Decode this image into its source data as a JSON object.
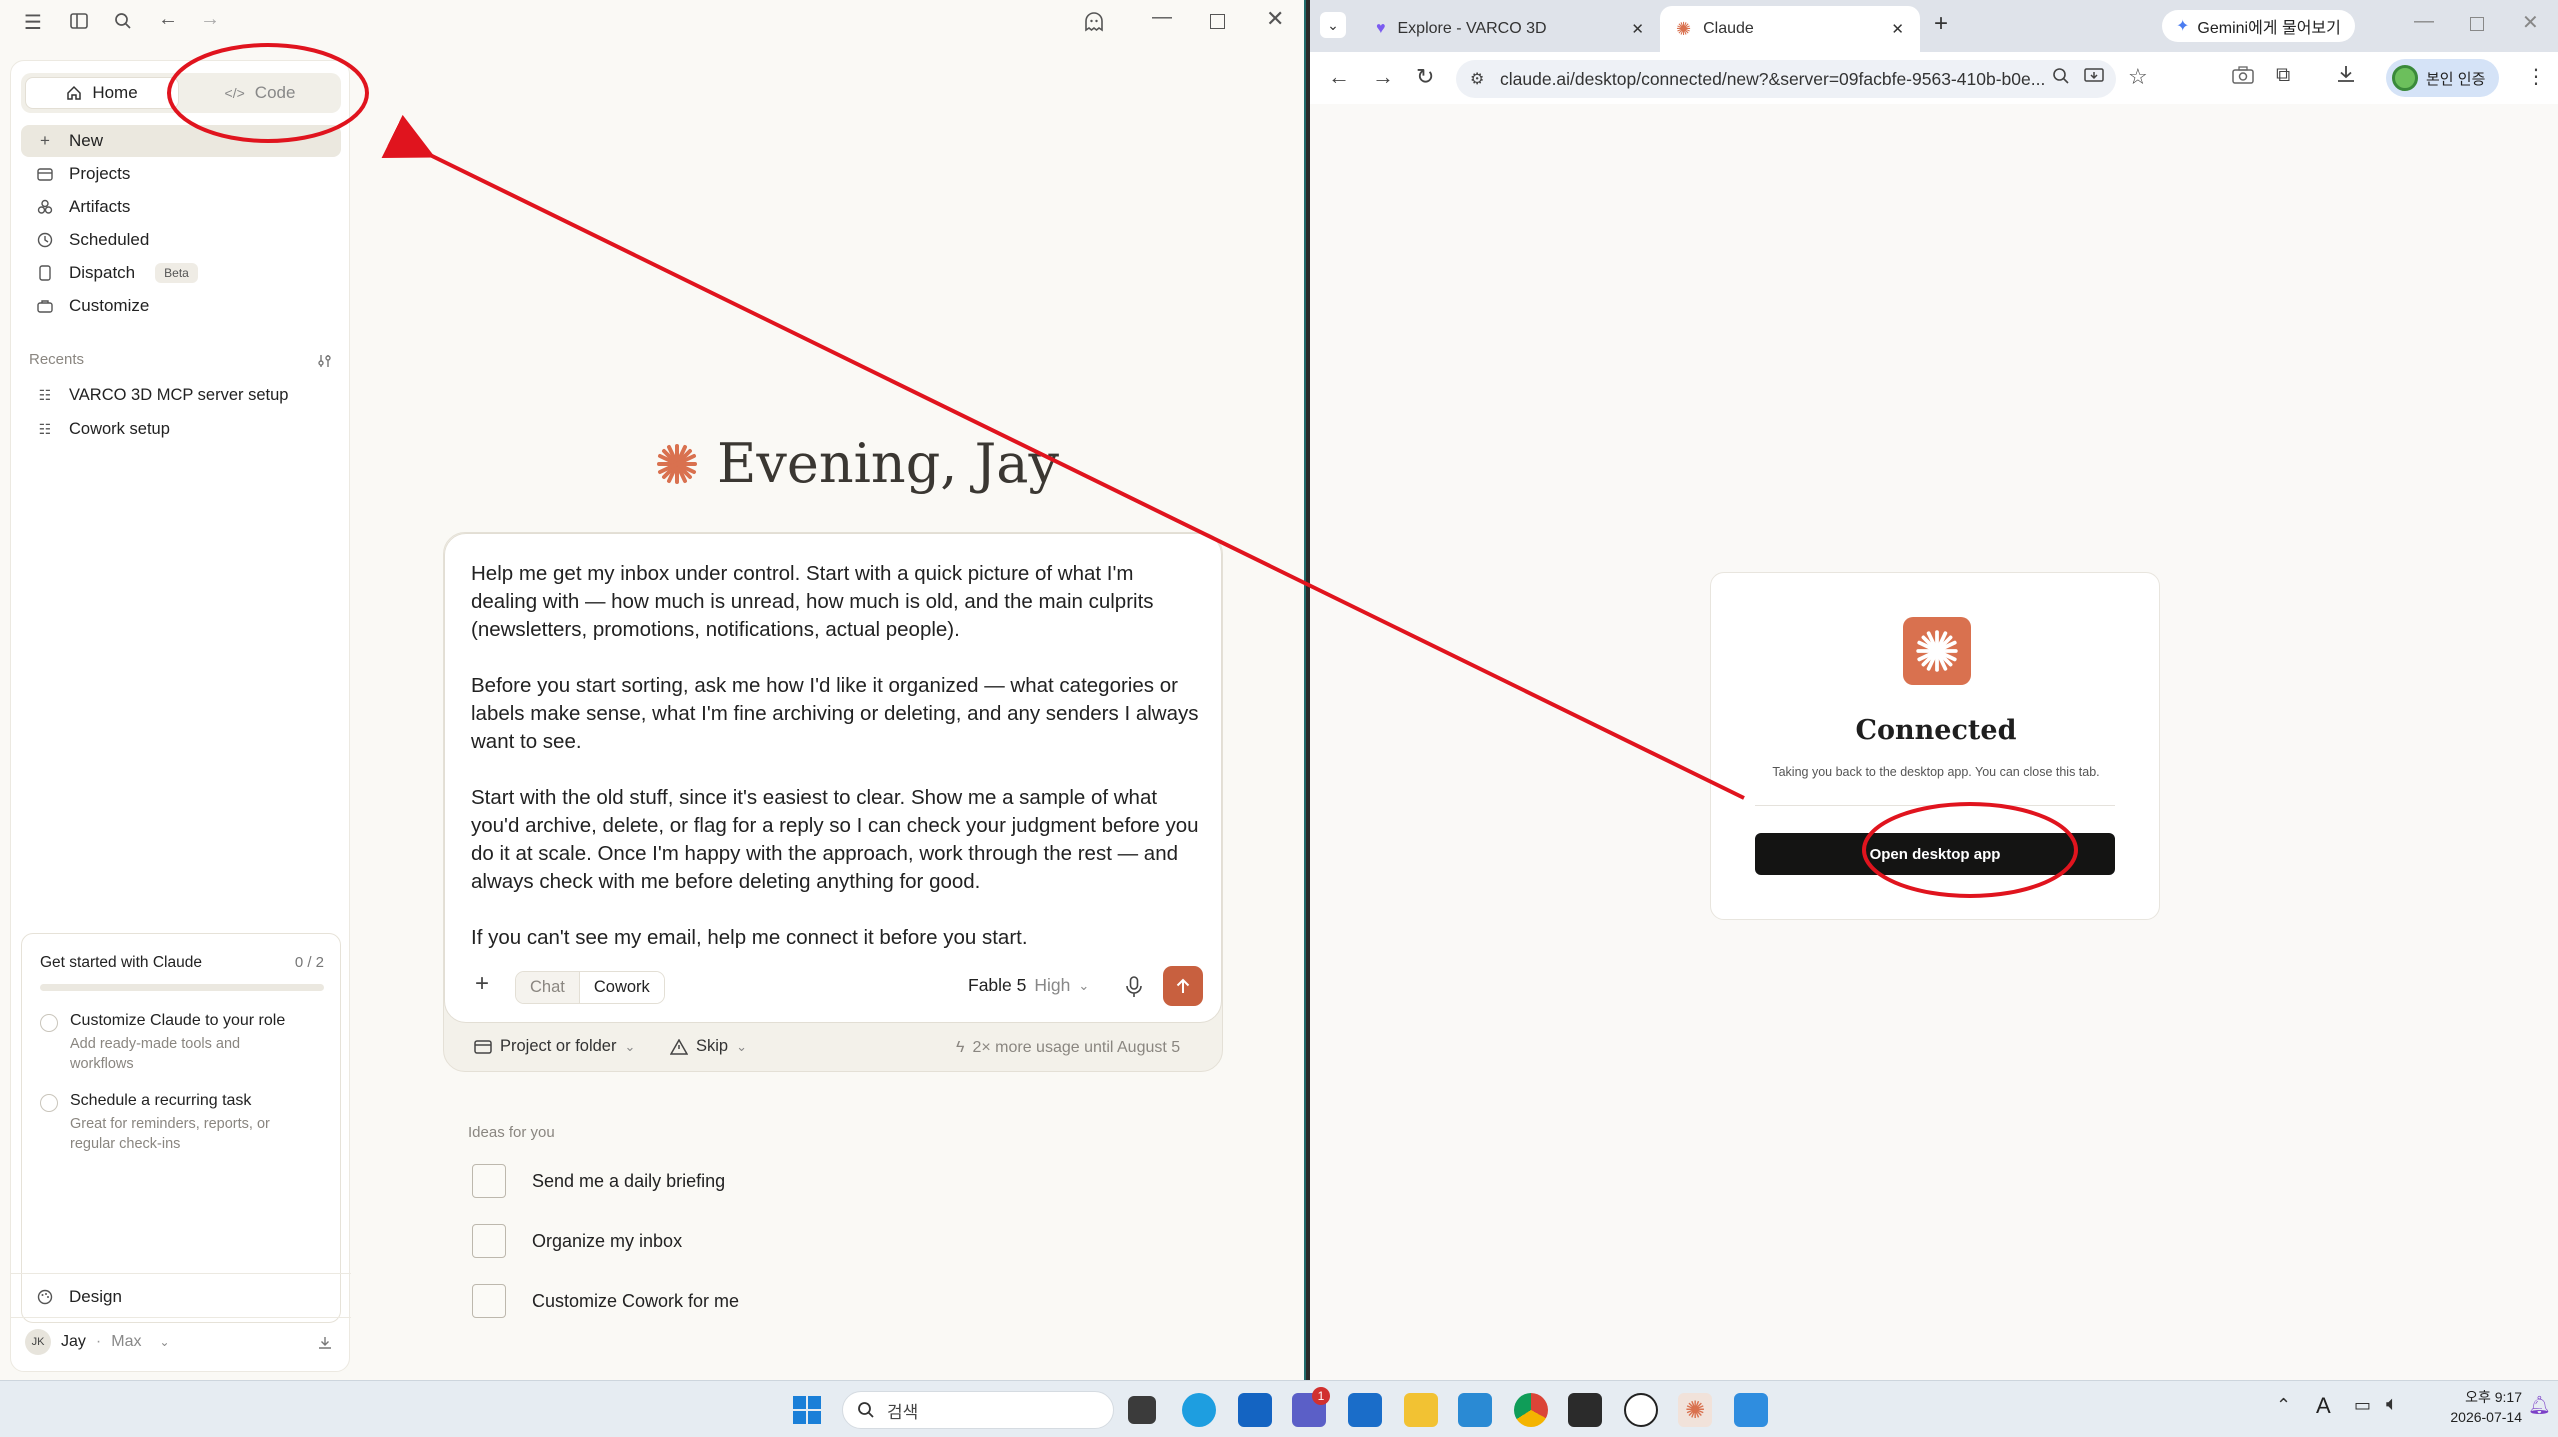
{
  "claude_app": {
    "mode_tabs": {
      "home": "Home",
      "code": "Code"
    },
    "nav": [
      {
        "label": "New",
        "icon": "plus-icon"
      },
      {
        "label": "Projects",
        "icon": "folder-icon"
      },
      {
        "label": "Artifacts",
        "icon": "artifacts-icon"
      },
      {
        "label": "Scheduled",
        "icon": "clock-icon"
      },
      {
        "label": "Dispatch",
        "icon": "phone-icon",
        "badge": "Beta"
      },
      {
        "label": "Customize",
        "icon": "briefcase-icon"
      }
    ],
    "recents_label": "Recents",
    "recents": [
      "VARCO 3D MCP server setup",
      "Cowork setup"
    ],
    "get_started": {
      "title": "Get started with Claude",
      "progress": "0 / 2",
      "progress_fraction": 0,
      "items": [
        {
          "title": "Customize Claude to your role",
          "sub": "Add ready-made tools and workflows"
        },
        {
          "title": "Schedule a recurring task",
          "sub": "Great for reminders, reports, or regular check-ins"
        }
      ]
    },
    "design_label": "Design",
    "user": {
      "initials": "JK",
      "name": "Jay",
      "plan": "Max"
    },
    "greeting": "Evening, Jay",
    "prompt": "Help me get my inbox under control. Start with a quick picture of what I'm dealing with — how much is unread, how much is old, and the main culprits (newsletters, promotions, notifications, actual people).\n\nBefore you start sorting, ask me how I'd like it organized — what categories or labels make sense, what I'm fine archiving or deleting, and any senders I always want to see.\n\nStart with the old stuff, since it's easiest to clear. Show me a sample of what you'd archive, delete, or flag for a reply so I can check your judgment before you do it at scale. Once I'm happy with the approach, work through the rest — and always check with me before deleting anything for good.\n\nIf you can't see my email, help me connect it before you start.",
    "composer": {
      "mode_chat": "Chat",
      "mode_cowork": "Cowork",
      "model": "Fable 5",
      "effort": "High",
      "project_folder": "Project or folder",
      "skip": "Skip",
      "usage_note": "2× more usage until August 5"
    },
    "ideas_label": "Ideas for you",
    "ideas": [
      "Send me a daily briefing",
      "Organize my inbox",
      "Customize Cowork for me"
    ]
  },
  "browser": {
    "tabs": [
      {
        "title": "Explore - VARCO 3D",
        "active": false
      },
      {
        "title": "Claude",
        "active": true
      }
    ],
    "gemini_button": "Gemini에게 물어보기",
    "url": "claude.ai/desktop/connected/new?&server=09facbfe-9563-410b-b0e...",
    "profile_label": "본인 인증",
    "card": {
      "title": "Connected",
      "subtitle": "Taking you back to the desktop app. You can close this tab.",
      "button": "Open desktop app"
    }
  },
  "taskbar": {
    "search_placeholder": "검색",
    "time": "오후 9:17",
    "date": "2026-07-14",
    "ime": "A",
    "notification_badge": "1"
  },
  "colors": {
    "accent": "#c8603f",
    "annotation": "#e0141e",
    "app_bg": "#faf9f5"
  }
}
